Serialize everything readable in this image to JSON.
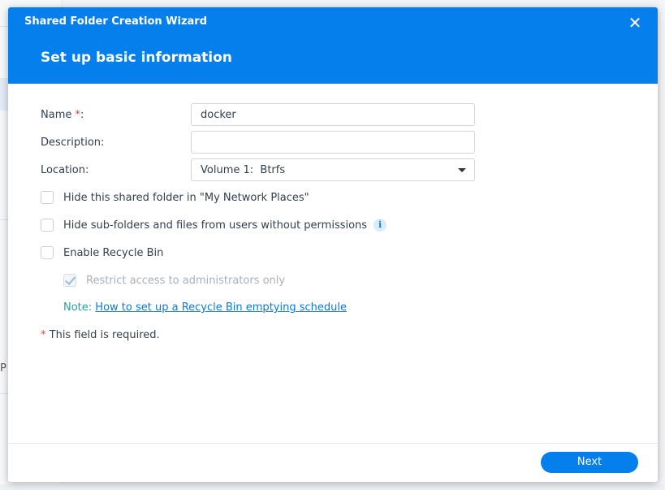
{
  "background": {
    "partial_text": "P"
  },
  "dialog": {
    "window_title": "Shared Folder Creation Wizard",
    "close_icon": "close-icon",
    "step_title": "Set up basic information"
  },
  "form": {
    "name": {
      "label": "Name ",
      "required_star": "*",
      "label_suffix": ":",
      "value": "docker"
    },
    "description": {
      "label": "Description:",
      "value": ""
    },
    "location": {
      "label": "Location:",
      "value": "Volume 1:  Btrfs"
    },
    "options": {
      "hide_shared": {
        "label": "Hide this shared folder in \"My Network Places\"",
        "checked": false
      },
      "hide_subfolders": {
        "label": "Hide sub-folders and files from users without permissions",
        "checked": false,
        "info_icon": "info-icon"
      },
      "recycle_bin": {
        "label": "Enable Recycle Bin",
        "checked": false
      },
      "restrict_admin": {
        "label": "Restrict access to administrators only",
        "checked": true,
        "disabled": true
      }
    },
    "note": {
      "prefix": "Note: ",
      "link": "How to set up a Recycle Bin emptying schedule"
    },
    "required_note": {
      "star": "*",
      "text": " This field is required."
    }
  },
  "footer": {
    "next_label": "Next"
  },
  "colors": {
    "accent": "#057feb",
    "required": "#e64040",
    "note": "#1fa3a0",
    "link": "#0a78d8"
  }
}
